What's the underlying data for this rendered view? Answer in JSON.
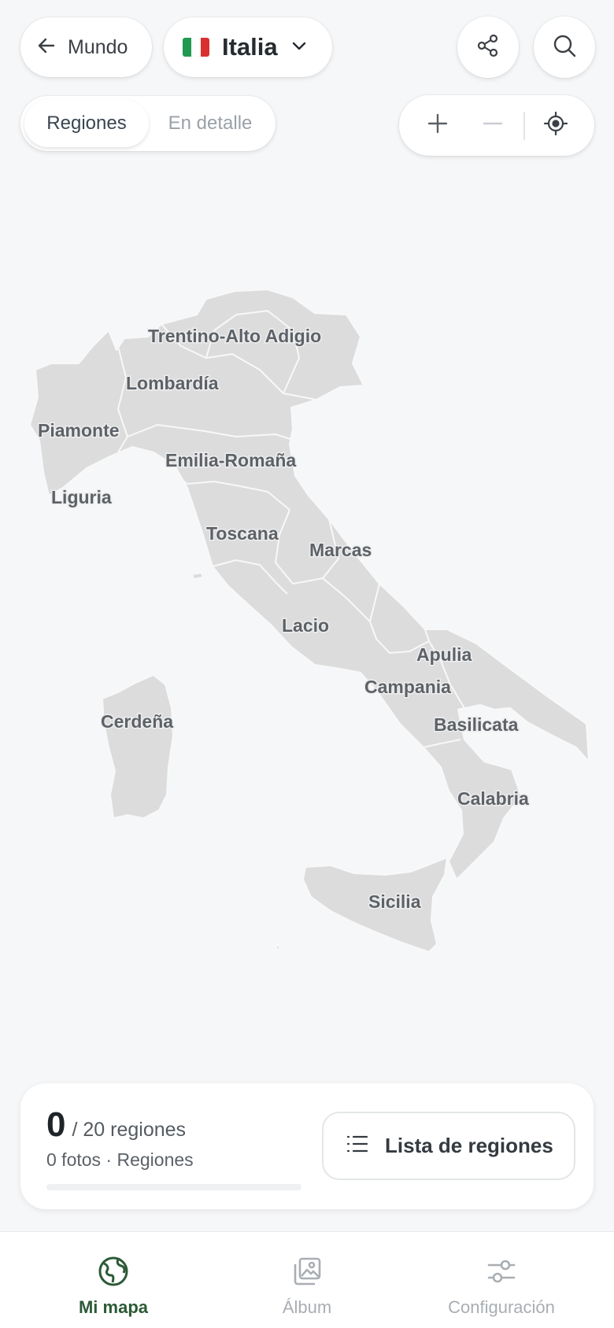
{
  "header": {
    "back_label": "Mundo",
    "country_label": "Italia",
    "flag_colors": [
      "#1f9a4f",
      "#ffffff",
      "#d9302f"
    ]
  },
  "view_mode": {
    "options": [
      "Regiones",
      "En detalle"
    ],
    "selected": "Regiones"
  },
  "map": {
    "land_color": "#dcdcdd",
    "border_color": "#f8f8f8",
    "regions": [
      "Trentino-Alto Adigio",
      "Lombardía",
      "Piamonte",
      "Emilia-Romaña",
      "Liguria",
      "Toscana",
      "Marcas",
      "Lacio",
      "Apulia",
      "Campania",
      "Cerdeña",
      "Basilicata",
      "Calabria",
      "Sicilia"
    ]
  },
  "stats": {
    "visited": "0",
    "total_text": "/ 20 regiones",
    "subtitle": "0 fotos · Regiones",
    "progress": 0,
    "list_button_label": "Lista de regiones"
  },
  "nav": {
    "items": [
      {
        "label": "Mi mapa",
        "icon": "globe-icon",
        "active": true
      },
      {
        "label": "Álbum",
        "icon": "album-icon",
        "active": false
      },
      {
        "label": "Configuración",
        "icon": "sliders-icon",
        "active": false
      }
    ]
  },
  "colors": {
    "accent": "#2b5a35",
    "background": "#f6f7f8"
  }
}
